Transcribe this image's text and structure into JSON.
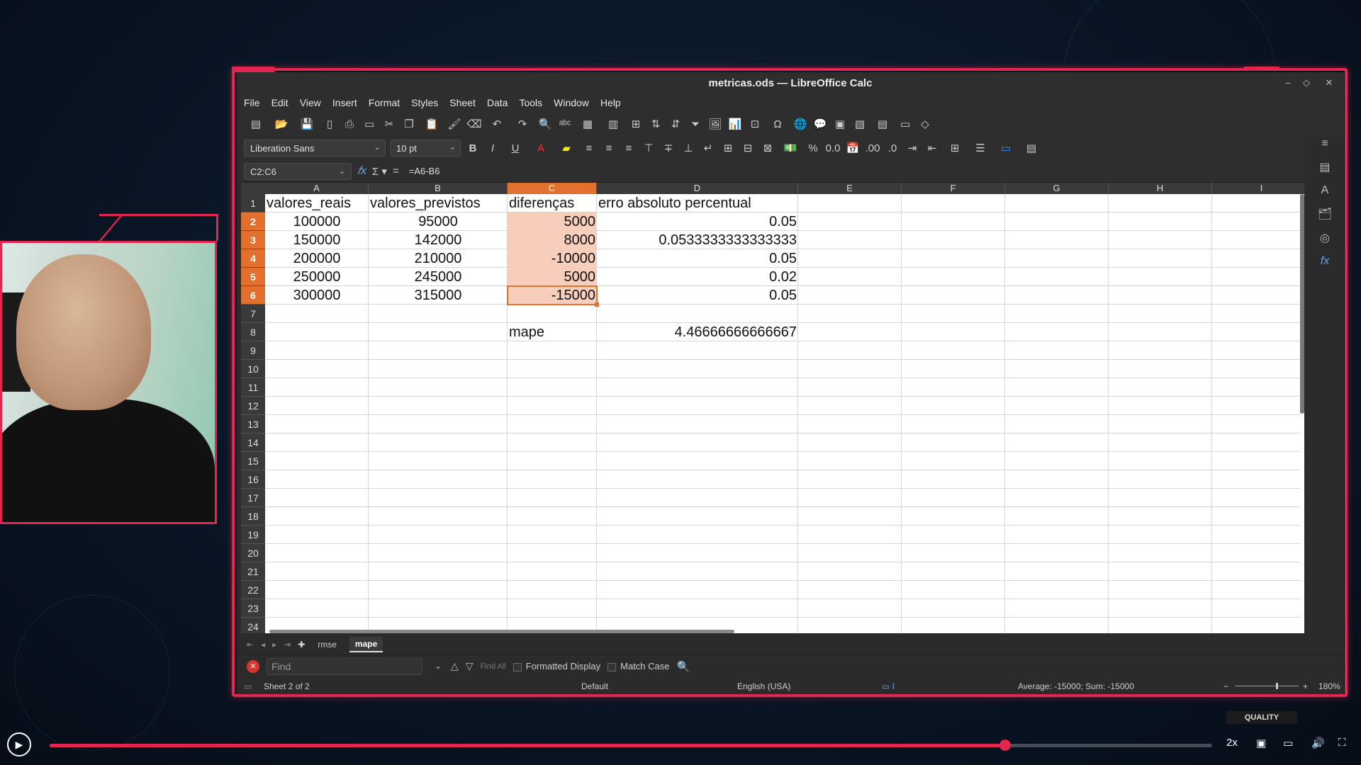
{
  "window": {
    "title": "metricas.ods — LibreOffice Calc"
  },
  "menu": [
    "File",
    "Edit",
    "View",
    "Insert",
    "Format",
    "Styles",
    "Sheet",
    "Data",
    "Tools",
    "Window",
    "Help"
  ],
  "format": {
    "font_name": "Liberation Sans",
    "font_size": "10 pt"
  },
  "formula_bar": {
    "cell_ref": "C2:C6",
    "formula": "=A6-B6"
  },
  "columns": [
    "A",
    "B",
    "C",
    "D",
    "E",
    "F",
    "G",
    "H",
    "I"
  ],
  "rows": [
    "1",
    "2",
    "3",
    "4",
    "5",
    "6",
    "7",
    "8",
    "9",
    "10",
    "11",
    "12",
    "13",
    "14",
    "15",
    "16",
    "17",
    "18",
    "19",
    "20",
    "21",
    "22",
    "23",
    "24"
  ],
  "cells": {
    "A1": "valores_reais",
    "B1": "valores_previstos",
    "C1": "diferenças",
    "D1": "erro absoluto percentual",
    "A2": "100000",
    "B2": "95000",
    "C2": "5000",
    "D2": "0.05",
    "A3": "150000",
    "B3": "142000",
    "C3": "8000",
    "D3": "0.0533333333333333",
    "A4": "200000",
    "B4": "210000",
    "C4": "-10000",
    "D4": "0.05",
    "A5": "250000",
    "B5": "245000",
    "C5": "5000",
    "D5": "0.02",
    "A6": "300000",
    "B6": "315000",
    "C6": "-15000",
    "D6": "0.05",
    "C8": "mape",
    "D8": "4.46666666666667"
  },
  "sheet_tabs": [
    "rmse",
    "mape"
  ],
  "active_tab": "mape",
  "find": {
    "placeholder": "Find",
    "find_all": "Find All",
    "formatted_display": "Formatted Display",
    "match_case": "Match Case"
  },
  "status": {
    "sheet": "Sheet 2 of 2",
    "style": "Default",
    "language": "English (USA)",
    "summary": "Average: -15000; Sum: -15000",
    "zoom": "180%"
  },
  "player": {
    "quality_label": "QUALITY",
    "speed": "2x",
    "progress": 0.822
  },
  "colors": {
    "accent": "#e4264e",
    "selection": "#e2702e",
    "selection_fill": "#f7cdbb"
  }
}
